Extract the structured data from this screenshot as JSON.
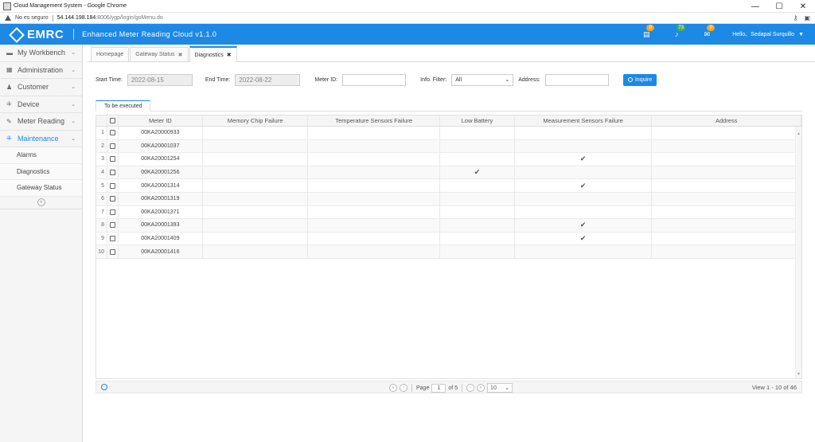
{
  "window": {
    "title": "Cloud Management System - Google Chrome",
    "controls": {
      "minimize": "—",
      "maximize": "☐",
      "close": "✕"
    }
  },
  "address": {
    "insecure_label": "No es seguro",
    "host": "54.144.198.184",
    "path": ":8006/ygp/login/goMenu.do"
  },
  "header": {
    "logo": "EMRC",
    "subtitle": "Enhanced Meter Reading Cloud v1.1.0",
    "badges": {
      "messages": "0",
      "alerts": "73",
      "mail": "0"
    },
    "user_greeting": "Hello、Sedapal Surquillo"
  },
  "sidebar": {
    "items": [
      {
        "label": "My Workbench",
        "icon": "monitor-icon"
      },
      {
        "label": "Administration",
        "icon": "grid-icon"
      },
      {
        "label": "Customer",
        "icon": "user-icon"
      },
      {
        "label": "Device",
        "icon": "spinner-icon"
      },
      {
        "label": "Meter Reading",
        "icon": "pencil-icon"
      },
      {
        "label": "Maintenance",
        "icon": "spinner-icon"
      }
    ],
    "sub_items": [
      "Alarms",
      "Diagnostics",
      "Gateway Status"
    ]
  },
  "tabs": [
    {
      "label": "Homepage"
    },
    {
      "label": "Gateway Status"
    },
    {
      "label": "Diagnostics"
    }
  ],
  "filters": {
    "start_label": "Start Time:",
    "start_value": "2022-08-15",
    "end_label": "End Time:",
    "end_value": "2022-08-22",
    "meter_label": "Meter ID:",
    "meter_value": "",
    "info_label": "Info. Filter:",
    "info_value": "All",
    "address_label": "Address:",
    "address_value": "",
    "inquire_label": "Inquire"
  },
  "subtab": {
    "label": "To be executed"
  },
  "grid": {
    "headers": [
      "Meter ID",
      "Memory Chip Failure",
      "Temperature Sensors Failure",
      "Low Battery",
      "Measurement Sensors Failure",
      "Address"
    ],
    "rows": [
      {
        "n": "1",
        "meter": "00KA20000933",
        "mem": false,
        "temp": false,
        "batt": false,
        "meas": false
      },
      {
        "n": "2",
        "meter": "00KA20001037",
        "mem": false,
        "temp": false,
        "batt": false,
        "meas": false
      },
      {
        "n": "3",
        "meter": "00KA20001254",
        "mem": false,
        "temp": false,
        "batt": false,
        "meas": true
      },
      {
        "n": "4",
        "meter": "00KA20001256",
        "mem": false,
        "temp": false,
        "batt": true,
        "meas": false
      },
      {
        "n": "5",
        "meter": "00KA20001314",
        "mem": false,
        "temp": false,
        "batt": false,
        "meas": true
      },
      {
        "n": "6",
        "meter": "00KA20001319",
        "mem": false,
        "temp": false,
        "batt": false,
        "meas": false
      },
      {
        "n": "7",
        "meter": "00KA20001371",
        "mem": false,
        "temp": false,
        "batt": false,
        "meas": false
      },
      {
        "n": "8",
        "meter": "00KA20001393",
        "mem": false,
        "temp": false,
        "batt": false,
        "meas": true
      },
      {
        "n": "9",
        "meter": "00KA20001409",
        "mem": false,
        "temp": false,
        "batt": false,
        "meas": true
      },
      {
        "n": "10",
        "meter": "00KA20001416",
        "mem": false,
        "temp": false,
        "batt": false,
        "meas": false
      }
    ]
  },
  "pager": {
    "page_label": "Page",
    "page_value": "1",
    "of_label": "of 5",
    "page_size": "10",
    "view_text": "View 1 - 10 of 46"
  },
  "colors": {
    "brand": "#1e88e5",
    "badge_orange": "#f5a623",
    "badge_green": "#4caf50"
  }
}
